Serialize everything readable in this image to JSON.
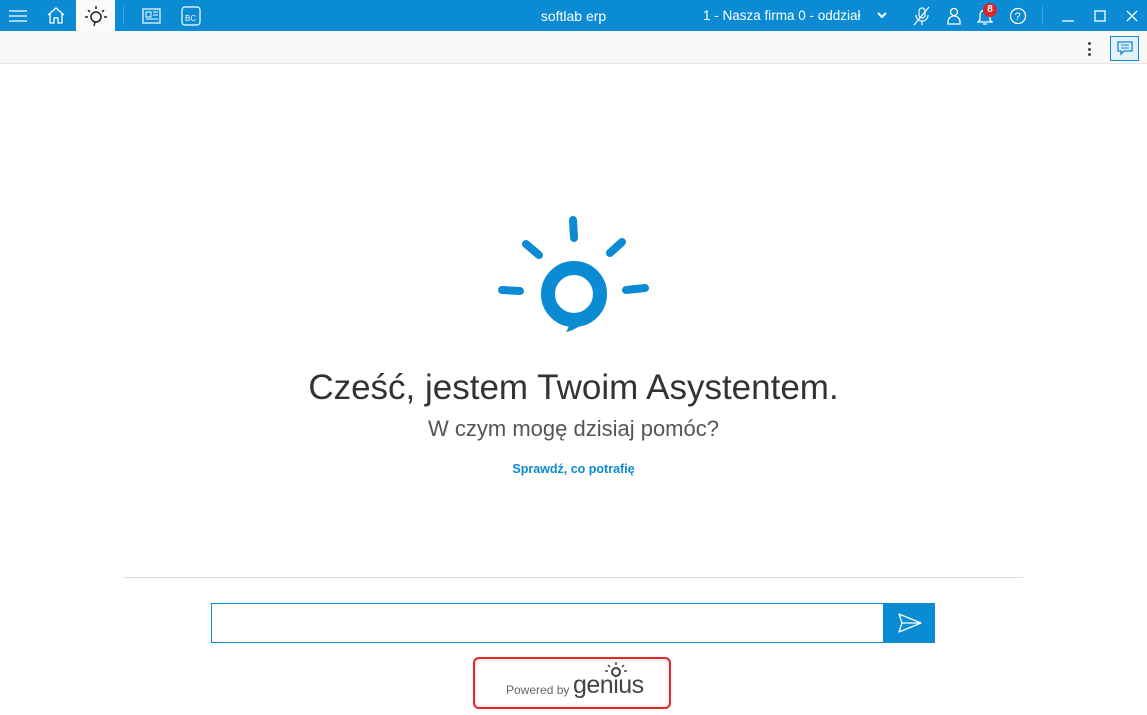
{
  "titlebar": {
    "app_title": "softlab erp",
    "company": "1 - Nasza firma 0 - oddział",
    "notifications_count": "8",
    "accent": "#0a8bd3"
  },
  "main": {
    "greeting_bold": "Cześć,",
    "greeting_rest": " jestem Twoim Asystentem.",
    "subtitle": "W czym mogę dzisiaj pomóc?",
    "link": "Sprawdź, co potrafię",
    "input_value": ""
  },
  "footer": {
    "powered_by": "Powered by",
    "brand": "genius"
  }
}
